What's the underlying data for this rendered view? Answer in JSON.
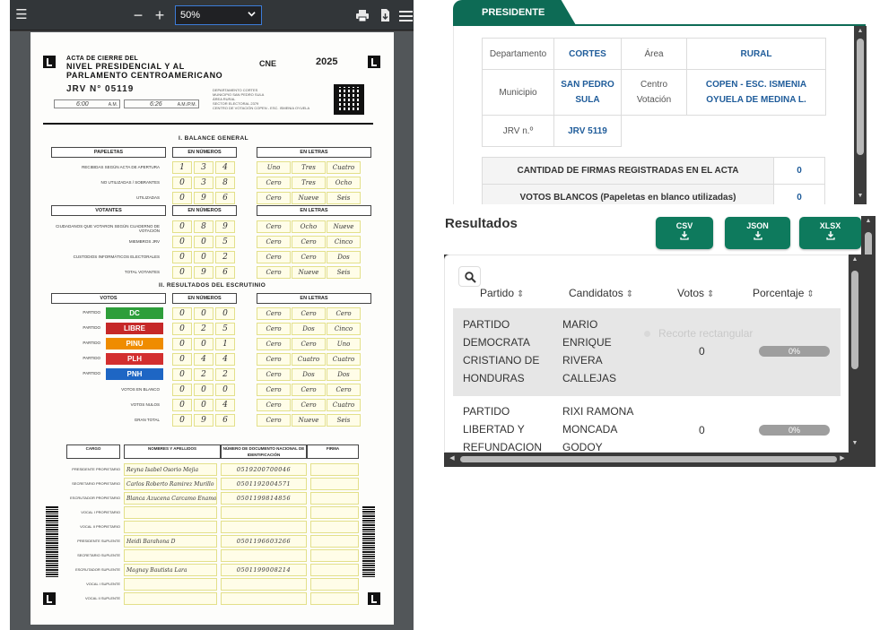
{
  "viewer": {
    "zoom_value": "50%",
    "minus": "−",
    "plus": "+",
    "print_glyph": "🖶",
    "download_glyph": "⤓",
    "menu_glyph": "≡",
    "sidebar_glyph": "☰"
  },
  "acta": {
    "title_line1": "ACTA DE CIERRE DEL",
    "title_line2": "NIVEL PRESIDENCIAL Y AL",
    "title_line3": "PARLAMENTO CENTROAMERICANO",
    "jrv": "JRV N° 05119",
    "time_open": "6:00",
    "time_open_suffix": "A.M.",
    "time_close": "6:26",
    "time_close_suffix": "A.M./P.M.",
    "cne_logo": "CNE",
    "logo_2025": "2025",
    "meta_lines": [
      "DEPARTAMENTO   CORTES",
      "MUNICIPIO   SAN PEDRO SULA",
      "ÁREA   RURAL",
      "SECTOR ELECTORAL   2379",
      "CENTRO DE VOTACIÓN   COPEN - ESC. ISMENIA OYUELA"
    ],
    "section1": "I. BALANCE GENERAL",
    "section2": "II. RESULTADOS DEL ESCRUTINIO",
    "h_papeletas": "PAPELETAS",
    "h_votantes": "VOTANTES",
    "h_votos": "VOTOS",
    "h_numeros": "EN NÚMEROS",
    "h_letras": "EN LETRAS",
    "papeletas_rows": [
      {
        "label": "RECIBIDAS SEGÚN ACTA DE APERTURA",
        "digits": [
          "1",
          "3",
          "4"
        ],
        "words": [
          "Uno",
          "Tres",
          "Cuatro"
        ]
      },
      {
        "label": "NO UTILIZADAS / SOBRANTES",
        "digits": [
          "0",
          "3",
          "8"
        ],
        "words": [
          "Cero",
          "Tres",
          "Ocho"
        ]
      },
      {
        "label": "UTILIZADAS",
        "digits": [
          "0",
          "9",
          "6"
        ],
        "words": [
          "Cero",
          "Nueve",
          "Seis"
        ]
      }
    ],
    "votantes_rows": [
      {
        "label": "CIUDADANOS QUE VOTARON SEGÚN CUADERNO DE VOTACIÓN",
        "digits": [
          "0",
          "8",
          "9"
        ],
        "words": [
          "Cero",
          "Ocho",
          "Nueve"
        ]
      },
      {
        "label": "MIEMBROS JRV",
        "digits": [
          "0",
          "0",
          "5"
        ],
        "words": [
          "Cero",
          "Cero",
          "Cinco"
        ]
      },
      {
        "label": "CUSTODIOS INFORMÁTICOS ELECTORALES",
        "digits": [
          "0",
          "0",
          "2"
        ],
        "words": [
          "Cero",
          "Cero",
          "Dos"
        ]
      },
      {
        "label": "TOTAL VOTANTES",
        "digits": [
          "0",
          "9",
          "6"
        ],
        "words": [
          "Cero",
          "Nueve",
          "Seis"
        ]
      }
    ],
    "votos_rows": [
      {
        "label": "DC",
        "color": "#2e9e3a",
        "digits": [
          "0",
          "0",
          "0"
        ],
        "words": [
          "Cero",
          "Cero",
          "Cero"
        ]
      },
      {
        "label": "LIBRE",
        "color": "#c62828",
        "digits": [
          "0",
          "2",
          "5"
        ],
        "words": [
          "Cero",
          "Dos",
          "Cinco"
        ]
      },
      {
        "label": "PINU",
        "color": "#ef8c00",
        "digits": [
          "0",
          "0",
          "1"
        ],
        "words": [
          "Cero",
          "Cero",
          "Uno"
        ]
      },
      {
        "label": "PLH",
        "color": "#d32f2f",
        "digits": [
          "0",
          "4",
          "4"
        ],
        "words": [
          "Cero",
          "Cuatro",
          "Cuatro"
        ]
      },
      {
        "label": "PNH",
        "color": "#1e66c4",
        "digits": [
          "0",
          "2",
          "2"
        ],
        "words": [
          "Cero",
          "Dos",
          "Dos"
        ]
      },
      {
        "label": "VOTOS EN BLANCO",
        "color": "",
        "digits": [
          "0",
          "0",
          "0"
        ],
        "words": [
          "Cero",
          "Cero",
          "Cero"
        ]
      },
      {
        "label": "VOTOS NULOS",
        "color": "",
        "digits": [
          "0",
          "0",
          "4"
        ],
        "words": [
          "Cero",
          "Cero",
          "Cuatro"
        ]
      },
      {
        "label": "GRAN TOTAL",
        "color": "",
        "digits": [
          "0",
          "9",
          "6"
        ],
        "words": [
          "Cero",
          "Nueve",
          "Seis"
        ]
      }
    ],
    "sig_headers": [
      "CARGO",
      "NOMBRES Y APELLIDOS",
      "NÚMERO DE DOCUMENTO NACIONAL DE IDENTIFICACIÓN",
      "FIRMA"
    ],
    "sig_rows": [
      {
        "cargo": "PRESIDENTE PROPIETARIO",
        "name": "Reyna Isabel Osorio Mejia",
        "doc": "0519200700046"
      },
      {
        "cargo": "SECRETARIO PROPIETARIO",
        "name": "Carlos Roberto Ramirez Murillo",
        "doc": "0501192004571"
      },
      {
        "cargo": "ESCRUTADOR PROPIETARIO",
        "name": "Blanca Azucena Carcamo Enamorado",
        "doc": "0501199814856"
      },
      {
        "cargo": "VOCAL I PROPIETARIO",
        "name": "",
        "doc": ""
      },
      {
        "cargo": "VOCAL II PROPIETARIO",
        "name": "",
        "doc": ""
      },
      {
        "cargo": "PRESIDENTE SUPLENTE",
        "name": "Heidi Barahona D",
        "doc": "0501196603266"
      },
      {
        "cargo": "SECRETARIO SUPLENTE",
        "name": "",
        "doc": ""
      },
      {
        "cargo": "ESCRUTADOR SUPLENTE",
        "name": "Magnay Bautista Lara",
        "doc": "0501199008214"
      },
      {
        "cargo": "VOCAL I SUPLENTE",
        "name": "",
        "doc": ""
      },
      {
        "cargo": "VOCAL II SUPLENTE",
        "name": "",
        "doc": ""
      }
    ]
  },
  "panel": {
    "tab_label": "PRESIDENTE",
    "info": {
      "departamento_label": "Departamento",
      "departamento_value": "CORTES",
      "area_label": "Área",
      "area_value": "RURAL",
      "municipio_label": "Municipio",
      "municipio_value": "SAN PEDRO SULA",
      "centro_label": "Centro Votación",
      "centro_value": "COPEN - ESC. ISMENIA OYUELA DE MEDINA L.",
      "jrv_label": "JRV n.º",
      "jrv_value": "JRV 5119"
    },
    "stats": [
      {
        "label": "CANTIDAD DE FIRMAS REGISTRADAS EN EL ACTA",
        "value": "0"
      },
      {
        "label": "VOTOS BLANCOS (Papeletas en blanco utilizadas)",
        "value": "0"
      }
    ],
    "results_title": "Resultados",
    "buttons": [
      {
        "label": "CSV"
      },
      {
        "label": "JSON"
      },
      {
        "label": "XLSX"
      }
    ],
    "columns": [
      "Partido",
      "Candidatos",
      "Votos",
      "Porcentaje"
    ],
    "ghost_tooltip": "Recorte rectangular",
    "rows": [
      {
        "partido": [
          "PARTIDO",
          "DEMOCRATA",
          "CRISTIANO DE",
          "HONDURAS"
        ],
        "candidato": [
          "MARIO",
          "ENRIQUE",
          "RIVERA",
          "CALLEJAS"
        ],
        "votos": "0",
        "porcentaje": "0%",
        "percent_value": 0
      },
      {
        "partido": [
          "PARTIDO",
          "LIBERTAD Y",
          "REFUNDACION"
        ],
        "candidato": [
          "RIXI RAMONA",
          "MONCADA",
          "GODOY"
        ],
        "votos": "0",
        "porcentaje": "0%",
        "percent_value": 0
      }
    ],
    "sort_glyph": "⇕",
    "download_glyph": "⤓"
  }
}
